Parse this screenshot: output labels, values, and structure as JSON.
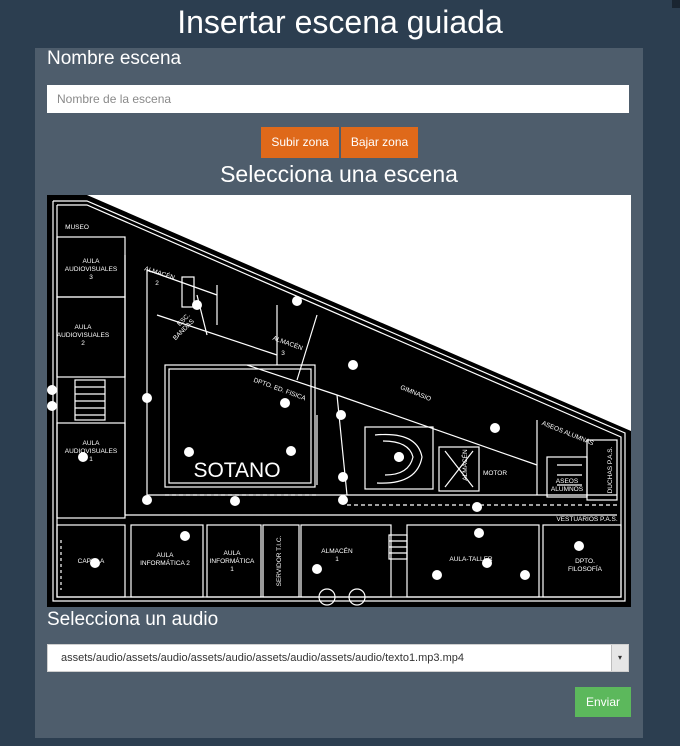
{
  "page": {
    "title": "Insertar escena guiada"
  },
  "form": {
    "name_label": "Nombre escena",
    "name_placeholder": "Nombre de la escena",
    "name_value": "",
    "zone_up_label": "Subir zona",
    "zone_down_label": "Bajar zona",
    "scene_label": "Selecciona una escena",
    "audio_label": "Selecciona un audio",
    "audio_selected": "assets/audio/assets/audio/assets/audio/assets/audio/assets/audio/texto1.mp3.mp4",
    "submit_label": "Enviar"
  },
  "floorplan": {
    "level_label": "SOTANO",
    "rooms": [
      "MUSEO",
      "AULA AUDIOVISUALES 3",
      "ALMACÉN 2",
      "AULA AUDIOVISUALES 2",
      "ESC. BANDAS",
      "ALMACÉN 3",
      "DPTO. ED. FISICA",
      "GIMNASIO",
      "AULA AUDIOVISUALES 1",
      "ALMACÉN E.F.",
      "MOTOR",
      "ASEOS ALUMNAS",
      "ASEOS ALUMNOS",
      "DUCHAS P.A.S.",
      "VESTUARIOS P.A.S.",
      "CAPILLA",
      "AULA INFORMÁTICA 2",
      "AULA INFORMÁTICA 1",
      "SERVIDOR T.I.C.",
      "ALMACÉN 1",
      "AULA-TALLER",
      "DPTO. FILOSOFÍA"
    ],
    "hotspot_count": 27
  },
  "colors": {
    "background": "#2c3e50",
    "panel": "#4e5d6c",
    "accent_orange": "#df691a",
    "accent_green": "#5cb85c"
  }
}
